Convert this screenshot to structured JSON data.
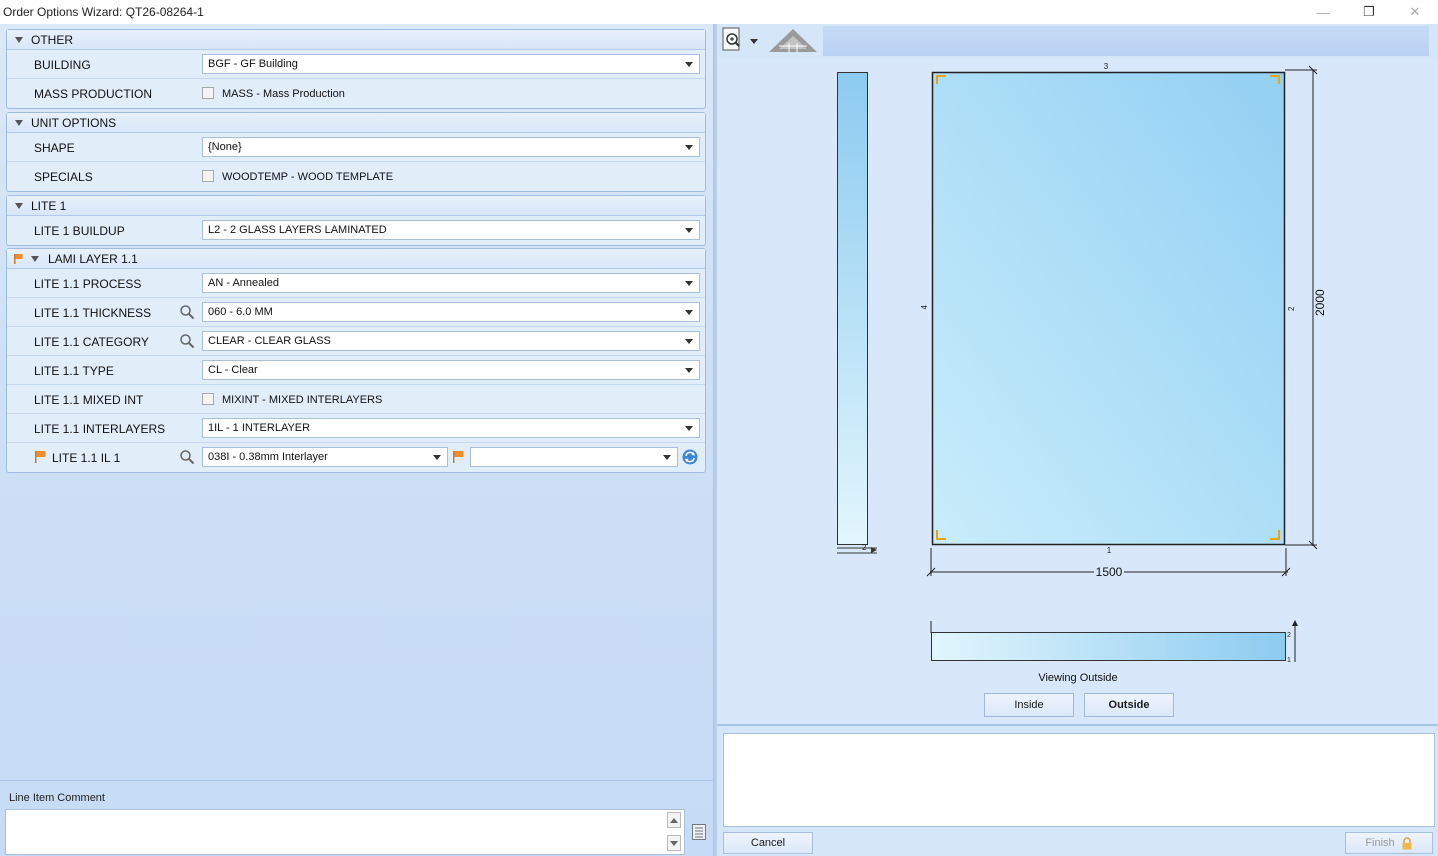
{
  "window": {
    "title": "Order Options Wizard: QT26-08264-1",
    "minimize_glyph": "—",
    "restore_glyph": "❐",
    "close_glyph": "✕"
  },
  "sections": {
    "other": {
      "title": "OTHER",
      "building": {
        "label": "BUILDING",
        "value": "BGF - GF Building"
      },
      "mass_production": {
        "label": "MASS PRODUCTION",
        "checkbox_label": "MASS - Mass Production",
        "checked": false
      }
    },
    "unit_options": {
      "title": "UNIT OPTIONS",
      "shape": {
        "label": "SHAPE",
        "value": "{None}"
      },
      "specials": {
        "label": "SPECIALS",
        "checkbox_label": "WOODTEMP - WOOD TEMPLATE",
        "checked": false
      }
    },
    "lite1": {
      "title": "LITE 1",
      "buildup": {
        "label": "LITE 1 BUILDUP",
        "value": "L2 - 2 GLASS LAYERS LAMINATED"
      }
    },
    "lami": {
      "title": "LAMI LAYER 1.1",
      "process": {
        "label": "LITE 1.1 PROCESS",
        "value": "AN - Annealed"
      },
      "thickness": {
        "label": "LITE 1.1 THICKNESS",
        "value": "060 - 6.0 MM"
      },
      "category": {
        "label": "LITE 1.1 CATEGORY",
        "value": "CLEAR - CLEAR GLASS"
      },
      "type": {
        "label": "LITE 1.1 TYPE",
        "value": "CL - Clear"
      },
      "mixed_int": {
        "label": "LITE 1.1 MIXED INT",
        "checkbox_label": "MIXINT - MIXED INTERLAYERS",
        "checked": false
      },
      "interlayers": {
        "label": "LITE 1.1 INTERLAYERS",
        "value": "1IL - 1 INTERLAYER"
      },
      "il1": {
        "label": "LITE 1.1 IL 1",
        "value": "038I - 0.38mm Interlayer",
        "secondary_value": ""
      }
    }
  },
  "comment": {
    "label": "Line Item Comment",
    "value": ""
  },
  "drawing": {
    "width_dim": "1500",
    "height_dim": "2000",
    "edge_top": "3",
    "edge_bottom": "1",
    "edge_left": "4",
    "edge_right": "2",
    "side_label": "2",
    "bottom_strip_top": "2",
    "bottom_strip_bottom": "1",
    "viewing_label": "Viewing Outside",
    "glass_color": "#a9dcf5",
    "corner_color": "#e8a317"
  },
  "view_buttons": {
    "inside": "Inside",
    "outside": "Outside"
  },
  "footer": {
    "cancel": "Cancel",
    "finish": "Finish"
  }
}
